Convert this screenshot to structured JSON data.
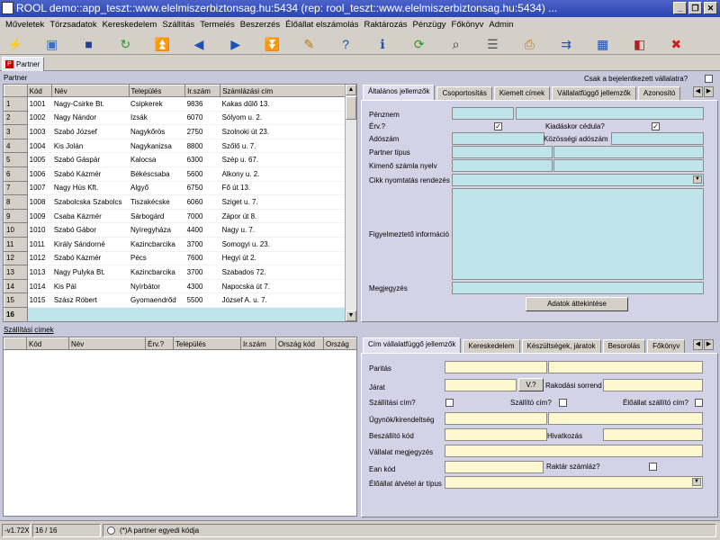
{
  "window": {
    "title": "ROOL demo::app_teszt::www.elelmiszerbiztonsag.hu:5434 (rep: rool_teszt::www.elelmiszerbiztonsag.hu:5434) ...",
    "minimize": "_",
    "maximize": "❐",
    "close": "✕"
  },
  "menu": [
    "Műveletek",
    "Törzsadatok",
    "Kereskedelem",
    "Szállítás",
    "Termelés",
    "Beszerzés",
    "Élőállat elszámolás",
    "Raktározás",
    "Pénzügy",
    "Főkönyv",
    "Admin"
  ],
  "toolbar": [
    {
      "icon": "lightning-icon",
      "glyph": "⚡",
      "color": "#d9a300"
    },
    {
      "icon": "open-icon",
      "glyph": "▣",
      "color": "#3a6fc4"
    },
    {
      "icon": "save-icon",
      "glyph": "■",
      "color": "#1f3f9f"
    },
    {
      "icon": "refresh-icon",
      "glyph": "↻",
      "color": "#2a9a2a"
    },
    {
      "icon": "first-record-icon",
      "glyph": "⏫",
      "color": "#1d4fb5"
    },
    {
      "icon": "previous-record-icon",
      "glyph": "◀",
      "color": "#1d4fb5"
    },
    {
      "icon": "next-record-icon",
      "glyph": "▶",
      "color": "#1d4fb5"
    },
    {
      "icon": "last-record-icon",
      "glyph": "⏬",
      "color": "#1d4fb5"
    },
    {
      "icon": "edit-icon",
      "glyph": "✎",
      "color": "#b07a1a"
    },
    {
      "icon": "help-icon",
      "glyph": "?",
      "color": "#1d4fb5"
    },
    {
      "icon": "info-icon",
      "glyph": "ℹ",
      "color": "#1d4fb5"
    },
    {
      "icon": "sync-icon",
      "glyph": "⟳",
      "color": "#2a9a2a"
    },
    {
      "icon": "search-icon",
      "glyph": "⌕",
      "color": "#333"
    },
    {
      "icon": "list-icon",
      "glyph": "☰",
      "color": "#555"
    },
    {
      "icon": "print-icon",
      "glyph": "⎙",
      "color": "#b07a1a"
    },
    {
      "icon": "export-icon",
      "glyph": "⇉",
      "color": "#1d4fb5"
    },
    {
      "icon": "table-icon",
      "glyph": "▦",
      "color": "#1d4fb5"
    },
    {
      "icon": "window-icon",
      "glyph": "◧",
      "color": "#b02020"
    },
    {
      "icon": "exit-icon",
      "glyph": "✖",
      "color": "#d02020"
    }
  ],
  "document_tab": "Partner",
  "partner_section": {
    "label": "Partner",
    "only_logged_company_label": "Csak a bejelentkezett vállalatra?",
    "columns": [
      "",
      "Kód",
      "Név",
      "Település",
      "Ir.szám",
      "Számlázási cím"
    ],
    "rows": [
      [
        "1",
        "1001",
        "Nagy-Csirke Bt.",
        "Csipkerek",
        "9836",
        "Kakas dűlő 13."
      ],
      [
        "2",
        "1002",
        "Nagy Nándor",
        "Izsák",
        "6070",
        "Sólyom u. 2."
      ],
      [
        "3",
        "1003",
        "Szabó József",
        "Nagykőrös",
        "2750",
        "Szolnoki út 23."
      ],
      [
        "4",
        "1004",
        "Kis Jolán",
        "Nagykanizsa",
        "8800",
        "Szőlő u. 7."
      ],
      [
        "5",
        "1005",
        "Szabó Gáspár",
        "Kalocsa",
        "6300",
        "Szép u. 67."
      ],
      [
        "6",
        "1006",
        "Szabó Kázmér",
        "Békéscsaba",
        "5600",
        "Alkony u. 2."
      ],
      [
        "7",
        "1007",
        "Nagy Hús Kft.",
        "Algyő",
        "6750",
        "Fő út 13."
      ],
      [
        "8",
        "1008",
        "Szabolcska Szabolcs",
        "Tiszakécske",
        "6060",
        "Sziget u. 7."
      ],
      [
        "9",
        "1009",
        "Csaba Kázmér",
        "Sárbogárd",
        "7000",
        "Zápor út 8."
      ],
      [
        "10",
        "1010",
        "Szabó Gábor",
        "Nyíregyháza",
        "4400",
        "Nagy u. 7."
      ],
      [
        "11",
        "1011",
        "Király Sándorné",
        "Kazincbarcika",
        "3700",
        "Somogyi u. 23."
      ],
      [
        "12",
        "1012",
        "Szabó Kázmér",
        "Pécs",
        "7600",
        "Hegyi út 2."
      ],
      [
        "13",
        "1013",
        "Nagy Pulyka Bt.",
        "Kazincbarcika",
        "3700",
        "Szabados 72."
      ],
      [
        "14",
        "1014",
        "Kis Pál",
        "Nyírbátor",
        "4300",
        "Napocska út 7."
      ],
      [
        "15",
        "1015",
        "Szász Róbert",
        "Gyomaendrőd",
        "5500",
        "József A. u. 7."
      ],
      [
        "16",
        "",
        "",
        "",
        "",
        ""
      ]
    ]
  },
  "general_tabs": [
    "Általános jellemzők",
    "Csoportosítás",
    "Kiemelt címek",
    "Vállalatfüggő jellemzők",
    "Azonosító"
  ],
  "general": {
    "penznem": "Pénznem",
    "erv": "Érv.?",
    "kiadaskor_cedula": "Kiadáskor cédula?",
    "adoszam": "Adószám",
    "kozossegi_adoszam": "Közösségi adószám",
    "partner_tipus": "Partner típus",
    "kimeno_szamla_nyelv": "Kimenő számla nyelv",
    "cikk_nyomtatas": "Cikk nyomtatás rendezés",
    "figyelmezteto": "Figyelmeztető információ",
    "megjegyzes": "Megjegyzés",
    "adatok_button": "Adatok áttekintése",
    "check_mark": "✓"
  },
  "shipping_section": {
    "label": "Szállítási címek",
    "columns": [
      "",
      "Kód",
      "Név",
      "Érv.?",
      "Település",
      "Ir.szám",
      "Ország kód",
      "Ország"
    ]
  },
  "company_tabs": [
    "Cím vállalatfüggő jellemzők",
    "Kereskedelem",
    "Készültségek, járatok",
    "Besorolás",
    "Főkönyv"
  ],
  "company": {
    "paritas": "Paritás",
    "jarat": "Járat",
    "v_button": "V.?",
    "rakodasi_sorrend": "Rakodási sorrend",
    "szallitasi_cim": "Szállítási cím?",
    "szallito_cim": "Szállító cím?",
    "eloallat_szallito_cim": "Élőállat szállító cím?",
    "ugynok": "Ügynök/kirendeltség",
    "beszallito_kod": "Beszállító kód",
    "hivatkozas": "Hivatkozás",
    "vallalat_megjegyzes": "Vállalat megjegyzés",
    "ean_kod": "Ean kód",
    "raktar_szamlaz": "Raktár számláz?",
    "eloallat_atvetel": "Élőállat átvétel ár típus"
  },
  "status": {
    "version": "-v1.72X",
    "record": "16 / 16",
    "note": "(*)A partner egyedi kódja"
  }
}
